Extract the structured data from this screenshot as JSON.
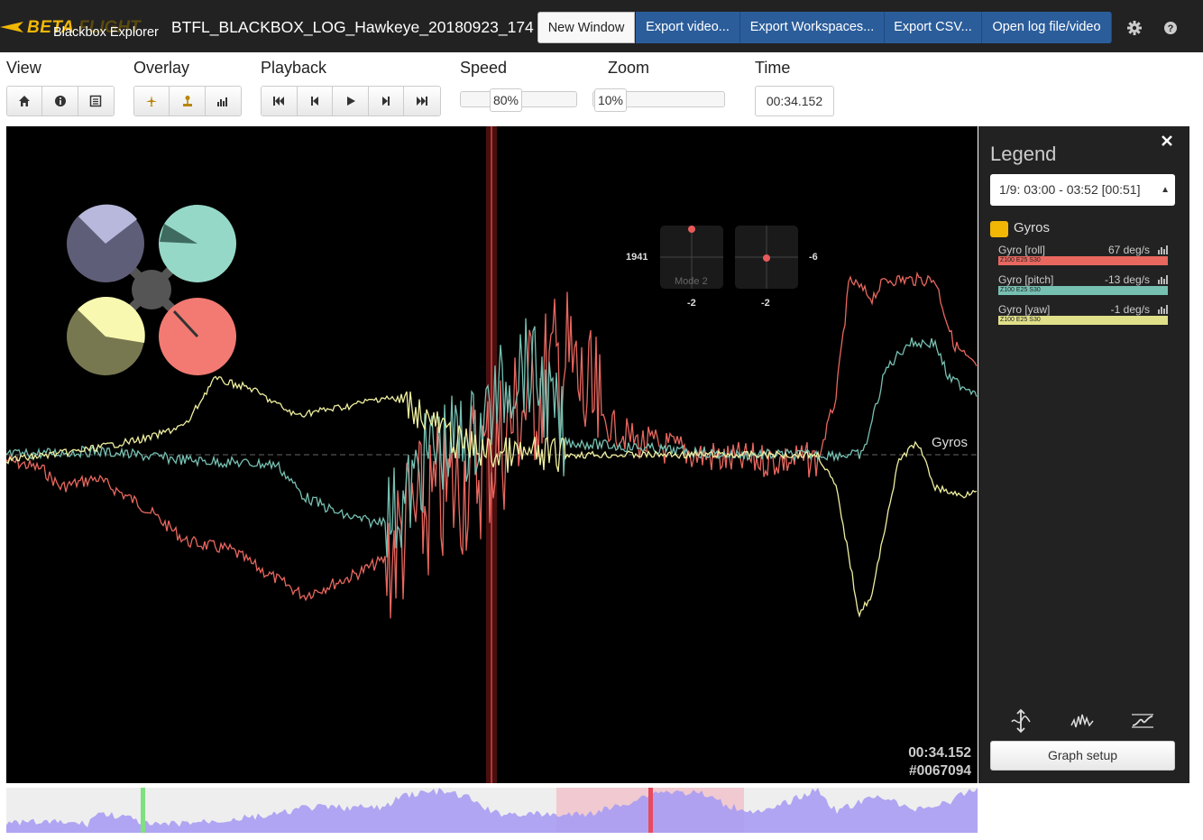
{
  "app": {
    "brand_beta": "BETA",
    "brand_flight": "FLIGHT",
    "brand_sub": "Blackbox Explorer",
    "log_title": "BTFL_BLACKBOX_LOG_Hawkeye_20180923_174"
  },
  "toolbar": {
    "new_window": "New Window",
    "export_video": "Export video...",
    "export_workspaces": "Export Workspaces...",
    "export_csv": "Export CSV...",
    "open_log": "Open log file/video",
    "settings_icon": "gear-icon",
    "help_icon": "help-icon"
  },
  "controls": {
    "view_label": "View",
    "overlay_label": "Overlay",
    "playback_label": "Playback",
    "speed_label": "Speed",
    "zoom_label": "Zoom",
    "time_label": "Time",
    "speed_value": "80%",
    "speed_fraction": 0.8,
    "zoom_value": "10%",
    "zoom_fraction": 0.1,
    "time_value": "00:34.152"
  },
  "graph": {
    "time_readout": "00:34.152",
    "frame_readout": "#0067094",
    "axis_group_label": "Gyros",
    "stick_left_label": "1941",
    "stick_right_label": "-6",
    "stick_left_bottom": "-2",
    "stick_right_bottom": "-2",
    "stick_mode": "Mode 2",
    "colors": {
      "roll": "#e8675f",
      "pitch": "#76c0b2",
      "yaw": "#f0f0a0"
    }
  },
  "legend": {
    "title": "Legend",
    "log_selector": "1/9: 03:00 - 03:52 [00:51]",
    "group": "Gyros",
    "fields": [
      {
        "name": "Gyro [roll]",
        "value": "67 deg/s",
        "filter": "Z100 E25 S30",
        "color": "#e8675f"
      },
      {
        "name": "Gyro [pitch]",
        "value": "-13 deg/s",
        "filter": "Z100 E25 S30",
        "color": "#76c0b2"
      },
      {
        "name": "Gyro [yaw]",
        "value": "-1 deg/s",
        "filter": "Z100 E25 S30",
        "color": "#e0e08a"
      }
    ],
    "graph_setup": "Graph setup"
  }
}
